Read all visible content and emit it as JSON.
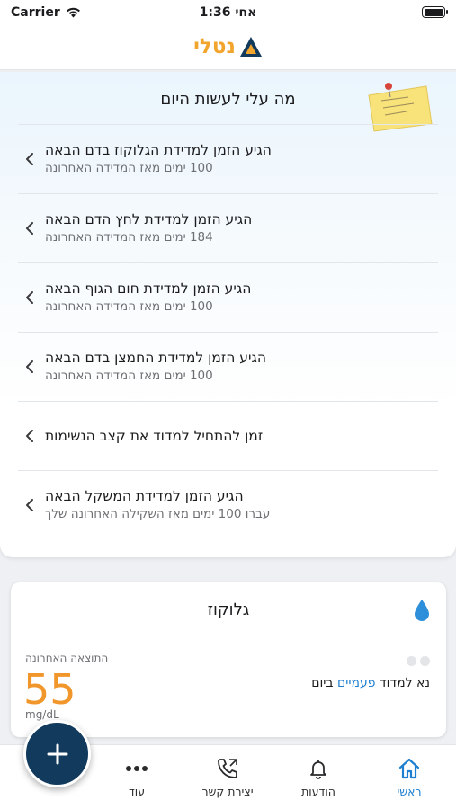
{
  "status_bar": {
    "carrier": "Carrier",
    "time": "1:36 אחי"
  },
  "header": {
    "logo_text": "נטלי"
  },
  "todo": {
    "title": "מה עלי לעשות היום",
    "items": [
      {
        "title": "הגיע הזמן למדידת הגלוקוז בדם הבאה",
        "subtitle": "100 ימים מאז המדידה האחרונה"
      },
      {
        "title": "הגיע הזמן למדידת לחץ הדם הבאה",
        "subtitle": "184 ימים מאז המדידה האחרונה"
      },
      {
        "title": "הגיע הזמן למדידת חום הגוף הבאה",
        "subtitle": "100 ימים מאז המדידה האחרונה"
      },
      {
        "title": "הגיע הזמן למדידת  החמצן בדם הבאה",
        "subtitle": "100 ימים מאז המדידה האחרונה"
      },
      {
        "title": "זמן להתחיל למדוד את קצב הנשימות",
        "subtitle": ""
      },
      {
        "title": "הגיע הזמן למדידת המשקל הבאה",
        "subtitle": "עברו 100 ימים מאז השקילה האחרונה שלך"
      }
    ]
  },
  "glucose": {
    "title": "גלוקוז",
    "last_result_label": "התוצאה האחרונה",
    "value": "55",
    "unit": "mg/dL",
    "instruction_prefix": "נא למדוד",
    "instruction_highlight": "פעמיים",
    "instruction_suffix": "ביום"
  },
  "tabbar": {
    "home": "ראשי",
    "notifications": "הודעות",
    "contact": "יצירת קשר",
    "more": "עוד"
  },
  "colors": {
    "accent": "#1f7fd0",
    "brand_orange": "#f0962a",
    "fab": "#123a5c"
  }
}
